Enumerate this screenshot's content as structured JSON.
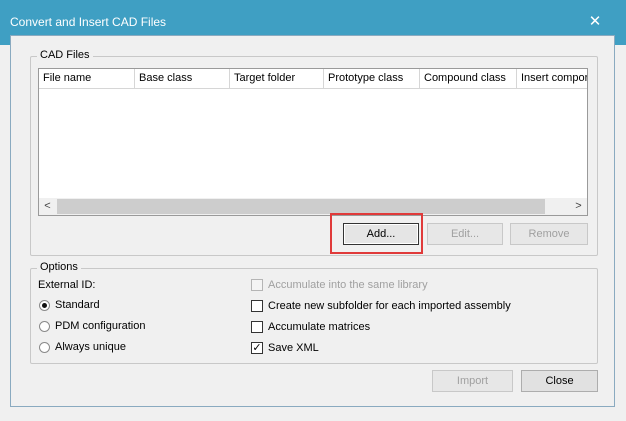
{
  "window": {
    "title": "Convert and Insert CAD Files",
    "close_glyph": "✕"
  },
  "cad_files": {
    "legend": "CAD Files",
    "columns": [
      "File name",
      "Base class",
      "Target folder",
      "Prototype class",
      "Compound class",
      "Insert compor"
    ],
    "scroll_left": "<",
    "scroll_right": ">",
    "buttons": {
      "add": "Add...",
      "edit": "Edit...",
      "remove": "Remove"
    }
  },
  "options": {
    "legend": "Options",
    "external_id_label": "External ID:",
    "radios": [
      {
        "label": "Standard",
        "checked": true
      },
      {
        "label": "PDM configuration",
        "checked": false
      },
      {
        "label": "Always unique",
        "checked": false
      }
    ],
    "checkboxes": [
      {
        "label": "Accumulate into the same library",
        "checked": false,
        "disabled": true
      },
      {
        "label": "Create new subfolder for each imported assembly",
        "checked": false,
        "disabled": false
      },
      {
        "label": "Accumulate matrices",
        "checked": false,
        "disabled": false
      },
      {
        "label": "Save XML",
        "checked": true,
        "disabled": false
      }
    ],
    "check_glyph": "✓"
  },
  "footer": {
    "import": "Import",
    "close": "Close"
  },
  "colors": {
    "titlebar": "#3f9fc3",
    "highlight": "#e03a3a"
  }
}
